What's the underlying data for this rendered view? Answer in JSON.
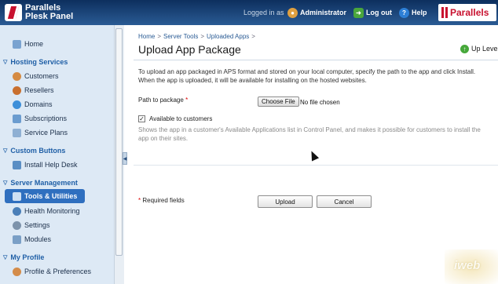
{
  "header": {
    "logo_line1": "Parallels",
    "logo_line2": "Plesk Panel",
    "logged_in_as": "Logged in as",
    "user": "Administrator",
    "logout": "Log out",
    "help": "Help",
    "brand": "Parallels"
  },
  "sidebar": {
    "home": "Home",
    "groups": [
      {
        "label": "Hosting Services",
        "items": [
          "Customers",
          "Resellers",
          "Domains",
          "Subscriptions",
          "Service Plans"
        ]
      },
      {
        "label": "Custom Buttons",
        "items": [
          "Install Help Desk"
        ]
      },
      {
        "label": "Server Management",
        "items": [
          "Tools & Utilities",
          "Health Monitoring",
          "Settings",
          "Modules"
        ]
      },
      {
        "label": "My Profile",
        "items": [
          "Profile & Preferences"
        ]
      }
    ],
    "selected_item": "Tools & Utilities"
  },
  "main": {
    "breadcrumb": [
      "Home",
      "Server Tools",
      "Uploaded Apps"
    ],
    "title": "Upload App Package",
    "up_level": "Up Level",
    "description": "To upload an app packaged in APS format and stored on your local computer, specify the path to the app and click Install. When the app is uploaded, it will be available for installing on the hosted websites.",
    "path_label": "Path to package",
    "required_mark": "*",
    "choose_file": "Choose File",
    "no_file": "No file chosen",
    "available_label": "Available to customers",
    "available_checked": true,
    "available_help": "Shows the app in a customer's Available Applications list in Control Panel, and makes it possible for customers to install the app on their sites.",
    "required_note": "Required fields",
    "upload_button": "Upload",
    "cancel_button": "Cancel"
  },
  "watermark": "iweb",
  "colors": {
    "header_bg": "#1b4373",
    "sidebar_bg": "#dde9f5",
    "group_title": "#1f5fa6",
    "selected_bg": "#2f6fbf",
    "brand_red": "#c8102e"
  }
}
